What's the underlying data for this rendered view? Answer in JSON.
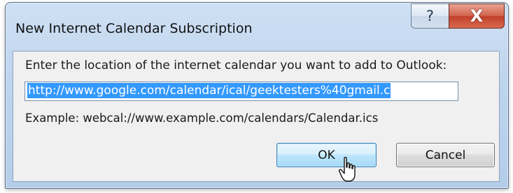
{
  "dialog": {
    "title": "New Internet Calendar Subscription",
    "help_glyph": "?",
    "close_glyph": "X",
    "prompt": "Enter the location of the internet calendar you want to add to Outlook:",
    "url_value": "http://www.google.com/calendar/ical/geektesters%40gmail.c",
    "example": "Example: webcal://www.example.com/calendars/Calendar.ics",
    "ok_label": "OK",
    "cancel_label": "Cancel"
  },
  "icons": {
    "help": "help-icon",
    "close": "close-icon",
    "cursor": "hand-pointer-cursor"
  },
  "colors": {
    "selection": "#3399ff",
    "close_button": "#c94a32",
    "ok_border": "#3c7fb1"
  }
}
